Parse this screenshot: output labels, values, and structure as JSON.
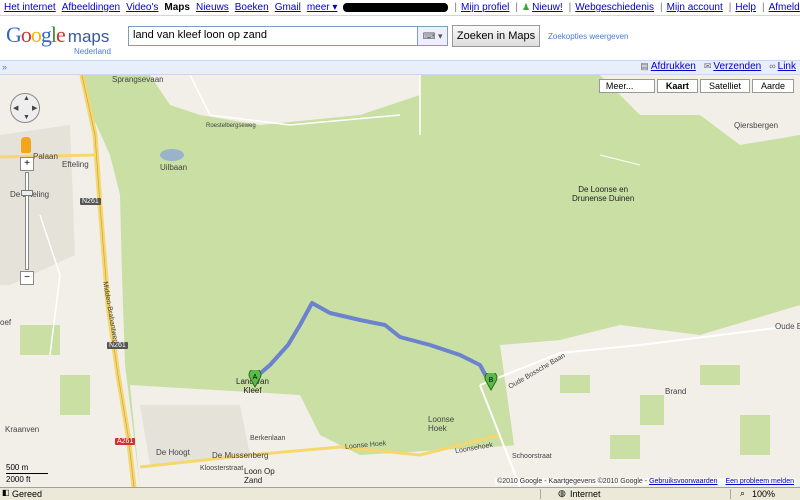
{
  "top_links": {
    "left": [
      {
        "label": "Het internet",
        "active": false
      },
      {
        "label": "Afbeeldingen",
        "active": false
      },
      {
        "label": "Video's",
        "active": false
      },
      {
        "label": "Maps",
        "active": true
      },
      {
        "label": "Nieuws",
        "active": false
      },
      {
        "label": "Boeken",
        "active": false
      },
      {
        "label": "Gmail",
        "active": false
      },
      {
        "label": "meer ▾",
        "active": false
      }
    ],
    "right": [
      "Mijn profiel",
      "Nieuw!",
      "Webgeschiedenis",
      "Mijn account",
      "Help",
      "Afmelden"
    ]
  },
  "header": {
    "logo_word": "Google",
    "logo_maps": "maps",
    "logo_country": "Nederland",
    "search_value": "land van kleef loon op zand",
    "search_button": "Zoeken in Maps",
    "search_options": "Zoekopties weergeven"
  },
  "actions": {
    "print": "Afdrukken",
    "send": "Verzenden",
    "link": "Link"
  },
  "map_types": {
    "more": "Meer...",
    "types": [
      {
        "label": "Kaart",
        "active": true
      },
      {
        "label": "Satelliet",
        "active": false
      },
      {
        "label": "Aarde",
        "active": false
      }
    ]
  },
  "zoom_buttons": {
    "in": "+",
    "out": "−"
  },
  "scale": {
    "metric": "500 m",
    "imperial": "2000 ft"
  },
  "map_labels": {
    "springsevaan": "Sprangsevaan",
    "roestelbergseweg": "Roestelbergseweg",
    "uilbaan": "Uilbaan",
    "efteling": "Efteling",
    "de_efteling": "De Efteling",
    "n261_1": "N261",
    "n261_2": "N261",
    "a261": "A261",
    "midden_brabantweg": "Midden-Brabantweg",
    "loonse_drunense": "De Loonse en\nDrunense Duinen",
    "qiersbergen": "Qiersbergen",
    "oude_bossche": "Oude Bo",
    "oude_baan": "Oude Bossche Baan",
    "land_van_kleef": "Land van\nKleef",
    "brand": "Brand",
    "loonse_hoek": "Loonse\nHoek",
    "de_hoogt": "De Hoogt",
    "de_mussenberg": "De Mussenberg",
    "berkenlaan": "Berkenlaan",
    "kloosterstraat": "Kloosterstraat",
    "loon_op_zand": "Loon Op\nZand",
    "kraanven": "Kraanven",
    "loonse_hoek_road": "Loonse Hoek",
    "loonsehoek": "Loonsehoek",
    "schoorstraat": "Schoorstraat",
    "palaan": "Palaan",
    "oef": "oef"
  },
  "markers": {
    "a": "A",
    "b": "B"
  },
  "credit": {
    "text": "©2010 Google - Kaartgegevens ©2010 Google - ",
    "terms": "Gebruiksvoorwaarden",
    "report": "Een probleem melden"
  },
  "status": {
    "left": "Gereed",
    "zone": "Internet",
    "zoom": "100%"
  },
  "colors": {
    "forest": "#c9dfa4",
    "urban": "#f2efe9",
    "route": "#5a72d6",
    "highway": "#f5d76e",
    "accent_link": "#0000cc"
  }
}
